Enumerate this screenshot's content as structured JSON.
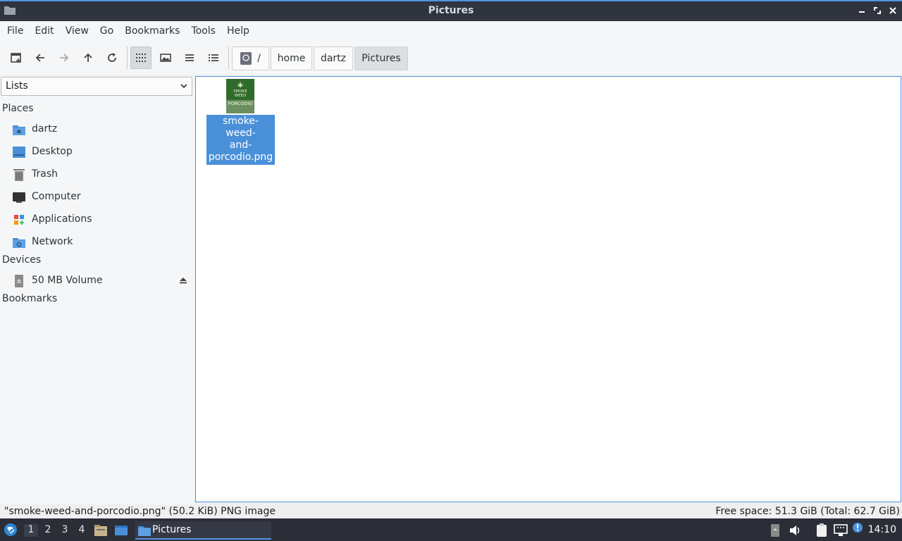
{
  "window": {
    "title": "Pictures"
  },
  "menu": [
    "File",
    "Edit",
    "View",
    "Go",
    "Bookmarks",
    "Tools",
    "Help"
  ],
  "toolbar": {
    "breadcrumb": {
      "root": "/",
      "parts": [
        "home",
        "dartz",
        "Pictures"
      ]
    }
  },
  "sidebar": {
    "select_value": "Lists",
    "places_header": "Places",
    "places": [
      {
        "label": "dartz",
        "icon": "home-folder-icon"
      },
      {
        "label": "Desktop",
        "icon": "desktop-icon"
      },
      {
        "label": "Trash",
        "icon": "trash-icon"
      },
      {
        "label": "Computer",
        "icon": "computer-icon"
      },
      {
        "label": "Applications",
        "icon": "applications-icon"
      },
      {
        "label": "Network",
        "icon": "network-icon"
      }
    ],
    "devices_header": "Devices",
    "devices": [
      {
        "label": "50 MB Volume",
        "icon": "drive-icon"
      }
    ],
    "bookmarks_header": "Bookmarks"
  },
  "files": [
    {
      "name_lines": [
        "smoke-weed-",
        "and-",
        "porcodio.png"
      ],
      "thumb_text": [
        "SMOKE",
        "WEED",
        "PORCODIO"
      ]
    }
  ],
  "status": {
    "left": "\"smoke-weed-and-porcodio.png\" (50.2 KiB) PNG image",
    "right": "Free space: 51.3 GiB (Total: 62.7 GiB)"
  },
  "taskbar": {
    "workspaces": [
      "1",
      "2",
      "3",
      "4"
    ],
    "active_window": "Pictures",
    "clock": "14:10"
  },
  "colors": {
    "accent": "#5294e2",
    "selection": "#4a90d9",
    "titlebar": "#2f343f",
    "taskbar": "#2b2e37"
  }
}
